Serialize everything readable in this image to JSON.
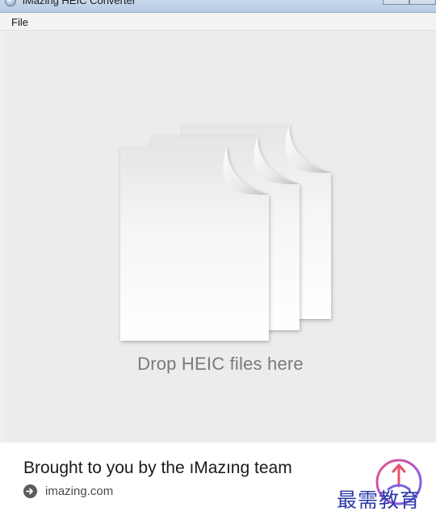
{
  "window": {
    "title": "iMazing HEIC Converter"
  },
  "menu": {
    "items": [
      {
        "label": "File"
      }
    ]
  },
  "dropzone": {
    "label": "Drop HEIC files here",
    "icon": "stacked-documents-icon"
  },
  "footer": {
    "title": "Brought to you by the ıMazıng team",
    "link_text": "imazing.com",
    "link_icon": "arrow-circle-icon"
  },
  "watermark": {
    "text": "最需教育"
  }
}
